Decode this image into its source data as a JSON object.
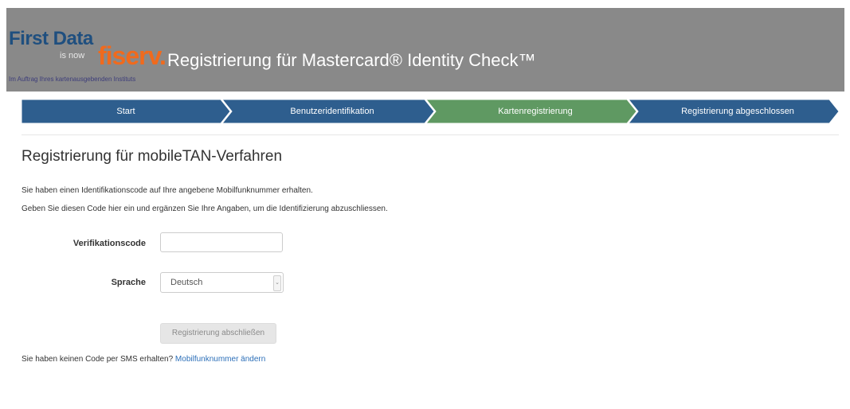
{
  "header": {
    "logo": {
      "brand": "First Data",
      "is_now": "is now",
      "fiserv": "fiserv.",
      "subline": "Im Auftrag Ihres kartenausgebenden Instituts"
    },
    "title": "Registrierung für Mastercard® Identity Check™",
    "background": "#898989"
  },
  "steps": [
    {
      "label": "Start",
      "state": "done",
      "color": "#2e5e8e"
    },
    {
      "label": "Benutzeridentifikation",
      "state": "done",
      "color": "#2e5e8e"
    },
    {
      "label": "Kartenregistrierung",
      "state": "active",
      "color": "#5f9962"
    },
    {
      "label": "Registrierung abgeschlossen",
      "state": "pending",
      "color": "#2e5e8e"
    }
  ],
  "main": {
    "heading": "Registrierung für mobileTAN-Verfahren",
    "intro_line1": "Sie haben einen Identifikationscode auf Ihre angebene Mobilfunknummer erhalten.",
    "intro_line2": "Geben Sie diesen Code hier ein und ergänzen Sie Ihre Angaben, um die Identifizierung abzuschliessen.",
    "form": {
      "code_label": "Verifikationscode",
      "code_value": "",
      "language_label": "Sprache",
      "language_value": "Deutsch",
      "submit_label": "Registrierung abschließen"
    },
    "sms_text": "Sie haben keinen Code per SMS erhalten?",
    "sms_link": "Mobilfunknummer ändern"
  }
}
